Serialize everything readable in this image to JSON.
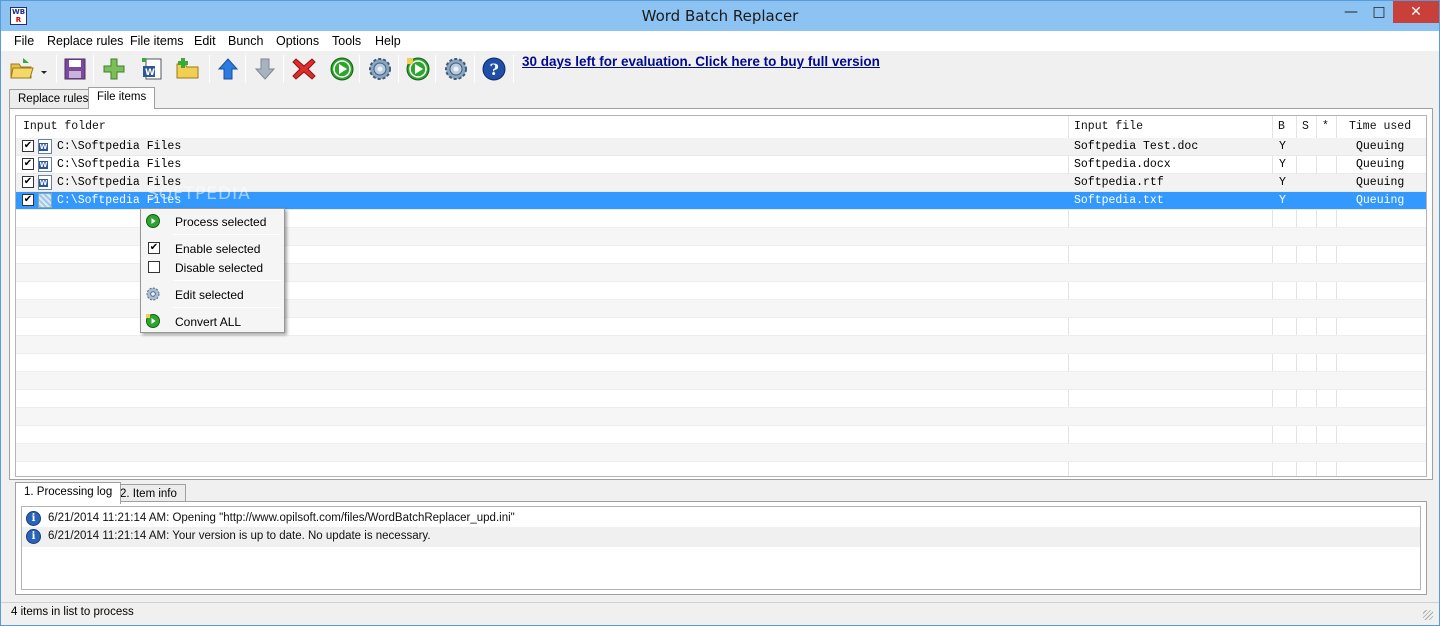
{
  "window": {
    "title": "Word Batch Replacer",
    "app_icon_top": "WB",
    "app_icon_bottom": "R",
    "minimize_glyph": "—",
    "maximize_glyph": "□",
    "close_glyph": "✕"
  },
  "menu": [
    "File",
    "Replace rules",
    "File items",
    "Edit",
    "Bunch",
    "Options",
    "Tools",
    "Help"
  ],
  "toolbar": {
    "icons": [
      "open-folder-icon",
      "dropdown-arrow-icon",
      "save-icon",
      "add-icon",
      "add-word-file-icon",
      "add-folder-icon",
      "move-up-icon",
      "move-down-icon",
      "delete-icon",
      "process-icon",
      "settings-icon",
      "convert-all-icon",
      "options-gear-icon",
      "help-icon"
    ],
    "eval_link": "30 days left for evaluation. Click here to buy full version"
  },
  "tabs_top": [
    {
      "label": "Replace rules",
      "active": false
    },
    {
      "label": "File items",
      "active": true
    }
  ],
  "grid": {
    "columns": [
      "Input folder",
      "Input file",
      "B",
      "S",
      "*",
      "Time used"
    ],
    "rows": [
      {
        "checked": true,
        "icon": "word-doc-icon",
        "folder": "C:\\Softpedia Files",
        "file": "Softpedia Test.doc",
        "b": "Y",
        "s": "",
        "star": "",
        "time": "Queuing"
      },
      {
        "checked": true,
        "icon": "word-doc-icon",
        "folder": "C:\\Softpedia Files",
        "file": "Softpedia.docx",
        "b": "Y",
        "s": "",
        "star": "",
        "time": "Queuing"
      },
      {
        "checked": true,
        "icon": "word-doc-icon",
        "folder": "C:\\Softpedia Files",
        "file": "Softpedia.rtf",
        "b": "Y",
        "s": "",
        "star": "",
        "time": "Queuing"
      },
      {
        "checked": true,
        "icon": "text-file-icon",
        "folder": "C:\\Softpedia Files",
        "file": "Softpedia.txt",
        "b": "Y",
        "s": "",
        "star": "",
        "time": "Queuing"
      }
    ],
    "check_glyph": "✔",
    "watermark": "SOFTPEDIA"
  },
  "context_menu": {
    "items": [
      {
        "label": "Process selected",
        "icon": "play-green-icon"
      },
      {
        "label": "Enable selected",
        "icon": "checkbox-checked-icon"
      },
      {
        "label": "Disable selected",
        "icon": "checkbox-empty-icon"
      },
      {
        "label": "Edit selected",
        "icon": "gear-icon"
      },
      {
        "label": "Convert ALL",
        "icon": "convert-all-icon"
      }
    ]
  },
  "tabs_bottom": [
    {
      "label": "1. Processing log",
      "active": true
    },
    {
      "label": "2. Item info",
      "active": false
    }
  ],
  "log": {
    "icon_glyph": "i",
    "entries": [
      "6/21/2014 11:21:14 AM: Opening \"http://www.opilsoft.com/files/WordBatchReplacer_upd.ini\"",
      "6/21/2014 11:21:14 AM: Your version is up to date. No update is necessary."
    ]
  },
  "status": {
    "text": "4 items in list to process"
  }
}
